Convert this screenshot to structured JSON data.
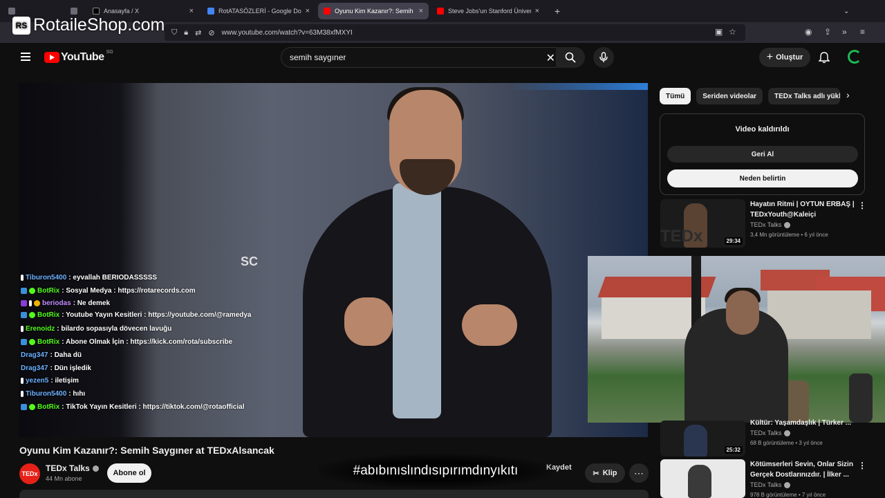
{
  "browser": {
    "tabs": [
      {
        "label": "",
        "color": "#6b6b75"
      },
      {
        "label": "",
        "color": "#6b6b75"
      },
      {
        "label": "Anasayfa / X",
        "color": "#000000"
      },
      {
        "label": "RotATASÖZLERİ - Google Doküm",
        "color": "#4285f4"
      },
      {
        "label": "Oyunu Kim Kazanır?: Semih Say",
        "color": "#ff0000"
      },
      {
        "label": "Steve Jobs'un Stanford Üniversi",
        "color": "#ff0000"
      }
    ],
    "new_tab": "+",
    "url": "www.youtube.com/watch?v=63M38xfMXYI"
  },
  "watermark": {
    "logo": "RS",
    "text": "RotaileShop.com"
  },
  "header": {
    "logo_text": "YouTube",
    "region": "SG",
    "search_value": "semih saygıner",
    "create_label": "Oluştur"
  },
  "video": {
    "stage_text": "SC",
    "title": "Oyunu Kim Kazanır?: Semih Saygıner at TEDxAlsancak",
    "channel": "TEDx Talks",
    "channel_avatar": "TEDx",
    "subscribers": "44 Mn abone",
    "subscribe_label": "Abone ol",
    "overlay_hashtag": "#abıbınıslındısıpırımdınyıkıtı",
    "save_label": "Kaydet",
    "clip_label": "Klip",
    "more_label": "⋯"
  },
  "chat": [
    {
      "user": "Tiburon5400",
      "text": ": eyvallah BERIODASSSSS",
      "badges": [
        "pin"
      ],
      "color": "blue"
    },
    {
      "user": "BotRix",
      "text": ": Sosyal Medya : https://rotarecords.com",
      "badges": [
        "bot",
        "check"
      ],
      "color": "green"
    },
    {
      "user": "beriodas",
      "text": ": Ne demek",
      "badges": [
        "mod",
        "pin",
        "coin"
      ],
      "color": "purple"
    },
    {
      "user": "BotRix",
      "text": ": Youtube Yayın Kesitleri : https://youtube.com/@ramedya",
      "badges": [
        "bot",
        "check"
      ],
      "color": "green",
      "wrap": true
    },
    {
      "user": "Erenoidz",
      "text": ": bilardo sopasıyla dövecen lavuğu",
      "badges": [
        "pin"
      ],
      "color": "green"
    },
    {
      "user": "BotRix",
      "text": ": Abone Olmak İçin : https://kick.com/rota/subscribe",
      "badges": [
        "bot",
        "check"
      ],
      "color": "green"
    },
    {
      "user": "Drag347",
      "text": ": Daha dü",
      "badges": [],
      "color": "blue"
    },
    {
      "user": "Drag347",
      "text": ": Dün işledik",
      "badges": [],
      "color": "blue"
    },
    {
      "user": "yezen5",
      "text": ": iletişim",
      "badges": [
        "pin"
      ],
      "color": "blue"
    },
    {
      "user": "Tiburon5400",
      "text": ": hıhı",
      "badges": [
        "pin"
      ],
      "color": "blue"
    },
    {
      "user": "BotRix",
      "text": ": TikTok Yayın Kesitleri : https://tiktok.com/@rotaofficial",
      "badges": [
        "bot",
        "check"
      ],
      "color": "green"
    }
  ],
  "sidebar": {
    "chips": [
      "Tümü",
      "Seriden videolar",
      "TEDx Talks adlı yükle"
    ],
    "removed": {
      "title": "Video kaldırıldı",
      "undo": "Geri Al",
      "why": "Neden belirtin"
    },
    "recommendations": [
      {
        "title": "Hayatın Ritmi | OYTUN ERBAŞ | TEDxYouth@Kaleiçi",
        "channel": "TEDx Talks",
        "meta": "3,4 Mn görüntüleme • 6 yıl önce",
        "duration": "29:34",
        "thumb_text": "TEDx"
      },
      {
        "title": "Kültür: Yaşamdaşlık | Türker ...",
        "channel": "TEDx Talks",
        "meta": "68 B görüntüleme • 3 yıl önce",
        "duration": "25:32",
        "thumb_text": ""
      },
      {
        "title": "Kötümserleri Sevin, Onlar Sizin Gerçek Dostlarınızdır. | İlker ...",
        "channel": "TEDx Talks",
        "meta": "978 B görüntüleme • 7 yıl önce",
        "duration": "",
        "thumb_text": ""
      }
    ]
  }
}
